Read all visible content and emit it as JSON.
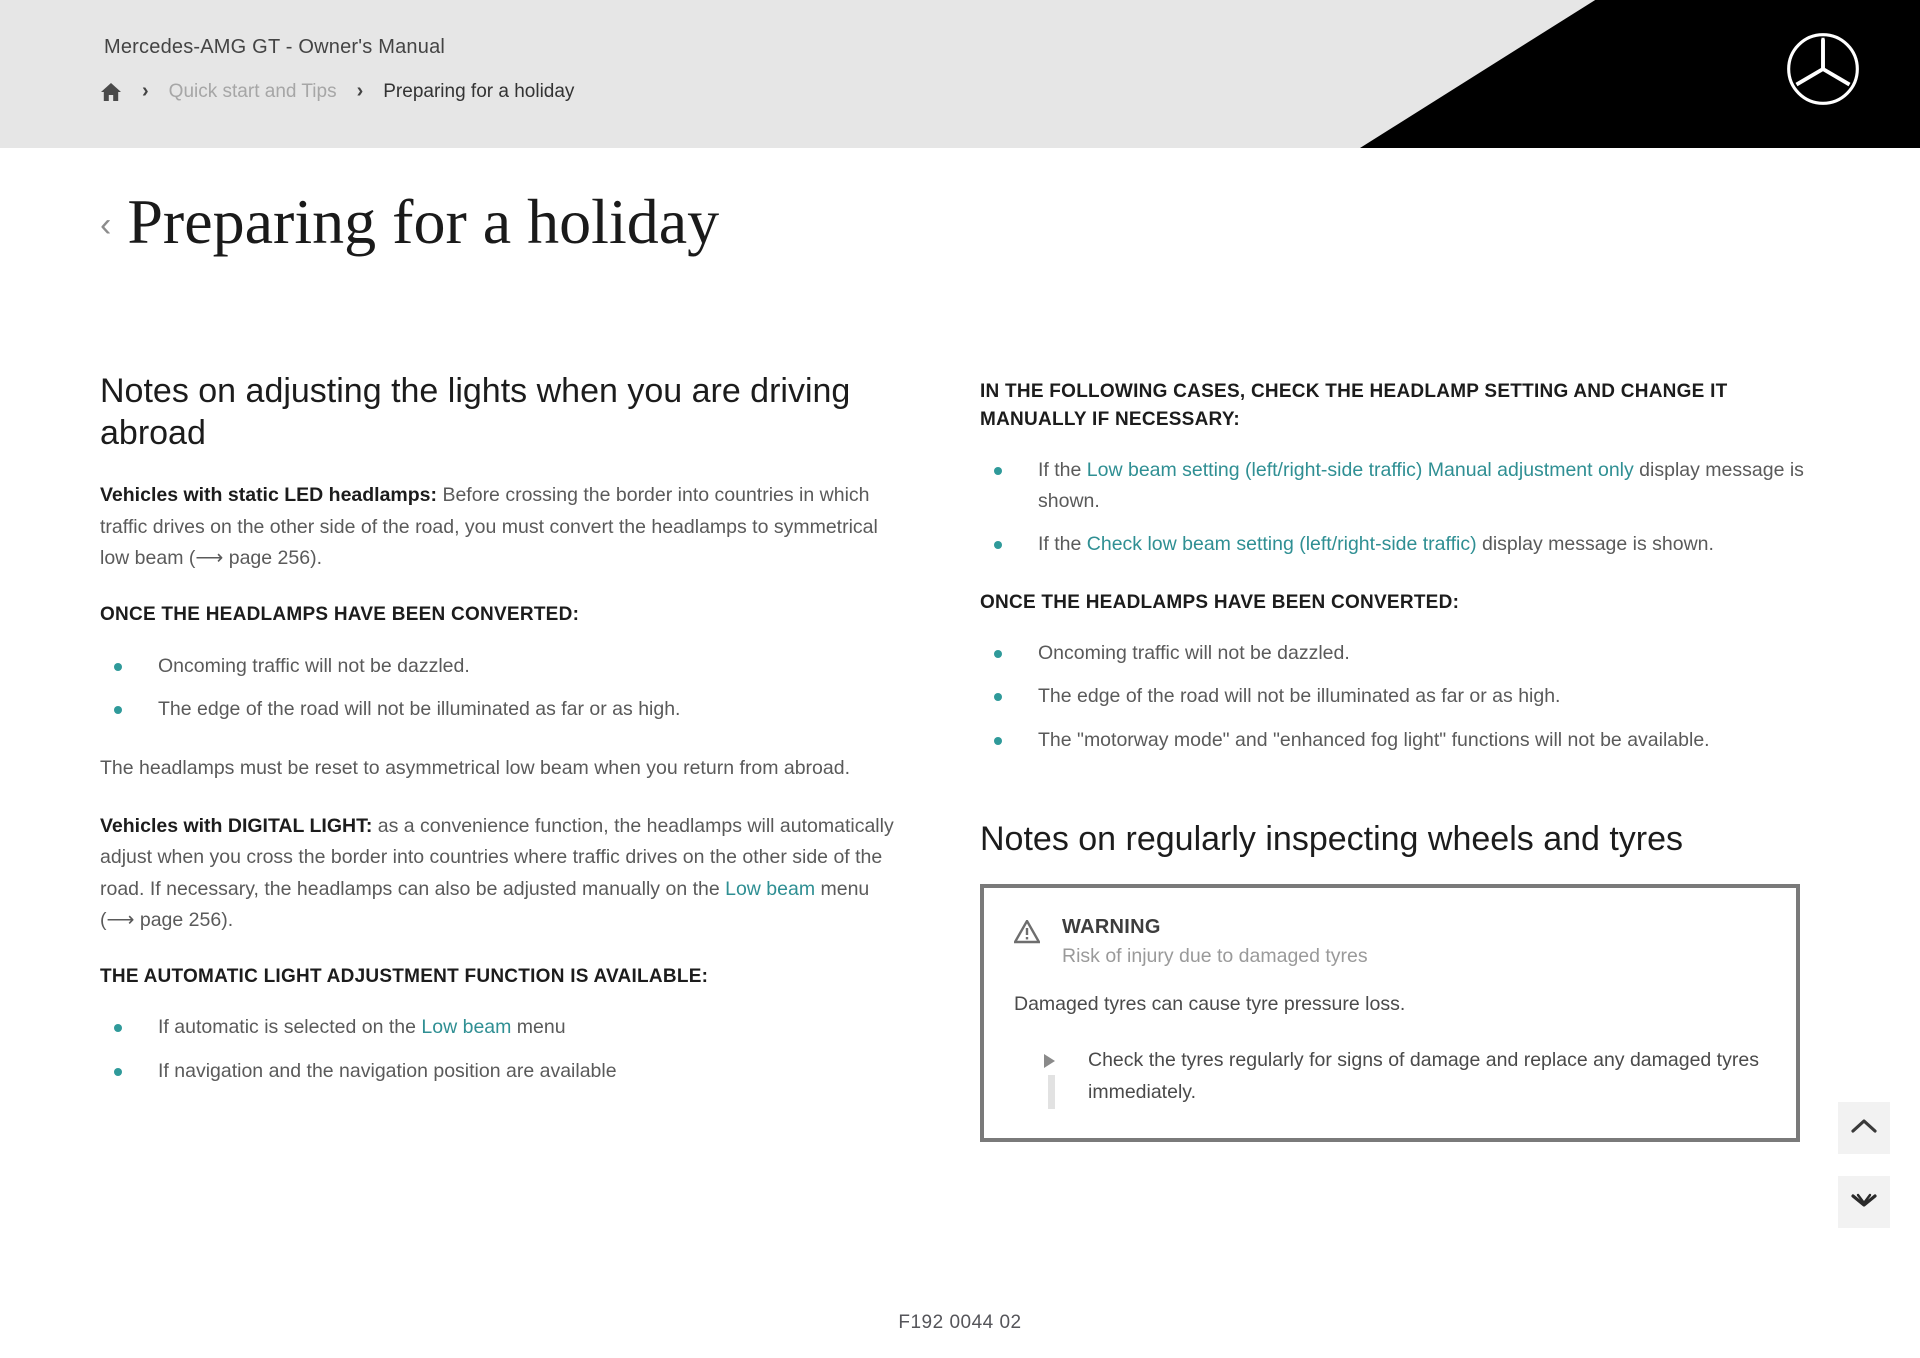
{
  "header": {
    "title": "Mercedes-AMG GT - Owner's Manual",
    "breadcrumb": {
      "home_icon": "home-icon",
      "sep": "›",
      "parent": "Quick start and Tips",
      "current": "Preparing for a holiday"
    },
    "logo_icon": "mercedes-star-logo",
    "colors": {
      "bar_bg": "#e6e6e6",
      "black_panel": "#000000"
    }
  },
  "page": {
    "back_chevron": "‹",
    "title": "Preparing for a holiday"
  },
  "left_column": {
    "heading": "Notes on adjusting the lights when you are driving abroad",
    "para_static_led": {
      "lead": "Vehicles with static LED headlamps:",
      "rest": " Before crossing the border into countries in which traffic drives on the other side of the road, you must convert the headlamps to symmetrical low beam (⟶ page 256)."
    },
    "converted_heading": "ONCE THE HEADLAMPS HAVE BEEN CONVERTED:",
    "converted_bullets": [
      "Oncoming traffic will not be dazzled.",
      "The edge of the road will not be illuminated as far or as high."
    ],
    "para_reset": "The headlamps must be reset to asymmetrical low beam when you return from abroad.",
    "para_digital_light": {
      "lead": "Vehicles with DIGITAL LIGHT:",
      "rest_1": " as a convenience function, the headlamps will automatically adjust when you cross the border into countries where traffic drives on the other side of the road. If necessary, the headlamps can also be adjusted manually on the ",
      "link": "Low beam",
      "rest_2": " menu (⟶ page 256)."
    },
    "auto_heading": "THE AUTOMATIC LIGHT ADJUSTMENT FUNCTION IS AVAILABLE:",
    "auto_bullets": [
      {
        "pre": "If automatic is selected on the ",
        "link": "Low beam",
        "post": " menu"
      },
      {
        "pre": "If navigation and the navigation position are available",
        "link": "",
        "post": ""
      }
    ]
  },
  "right_column": {
    "check_heading": "IN THE FOLLOWING CASES, CHECK THE HEADLAMP SETTING AND CHANGE IT MANUALLY IF NECESSARY:",
    "check_bullets": [
      {
        "pre": "If the ",
        "link": "Low beam setting (left/right-side traffic) Manual adjustment only",
        "post": " display message is shown."
      },
      {
        "pre": "If the ",
        "link": "Check low beam setting (left/right-side traffic)",
        "post": " display message is shown."
      }
    ],
    "converted_heading": "ONCE THE HEADLAMPS HAVE BEEN CONVERTED:",
    "converted_bullets": [
      "Oncoming traffic will not be dazzled.",
      "The edge of the road will not be illuminated as far or as high.",
      "The \"motorway mode\" and \"enhanced fog light\" functions will not be available."
    ],
    "wheels_heading": "Notes on regularly inspecting wheels and tyres",
    "warning": {
      "icon": "warning-triangle-icon",
      "title": "WARNING",
      "subtitle": "Risk of injury due to damaged tyres",
      "text": "Damaged tyres can cause tyre pressure loss.",
      "actions": [
        "Check the tyres regularly for signs of damage and replace any damaged tyres immediately."
      ]
    }
  },
  "float_buttons": [
    {
      "name": "scroll-up-button",
      "icon": "chevron-up-icon"
    },
    {
      "name": "scroll-down-button",
      "icon": "chevron-down-icon"
    }
  ],
  "footer": {
    "doc_code": "F192 0044 02"
  },
  "colors": {
    "accent_teal": "#2f8f93",
    "bullet_teal": "#2f9a9a",
    "body_text": "#5a5a5a",
    "heading_text": "#1c1c1c",
    "warning_border": "#7a7a7a"
  }
}
